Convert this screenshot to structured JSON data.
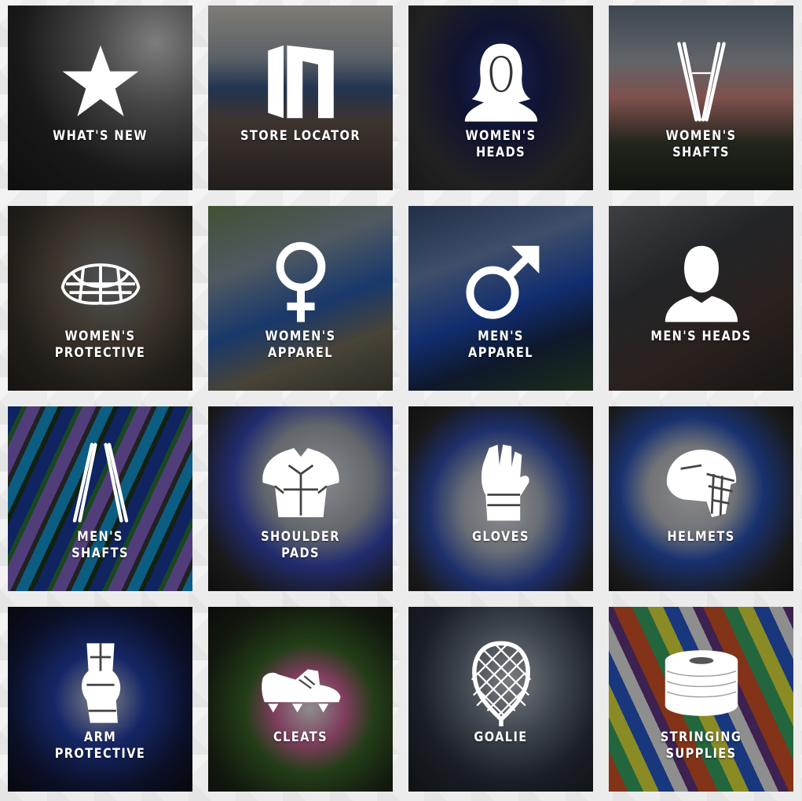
{
  "colors": {
    "page_background": "#ececec",
    "label_text": "#ffffff",
    "icon_fill": "#ffffff"
  },
  "tiles": [
    {
      "label": "WHAT'S NEW",
      "icon": "star-icon"
    },
    {
      "label": "STORE LOCATOR",
      "icon": "store-logo-icon"
    },
    {
      "label": "WOMEN'S\nHEADS",
      "icon": "woman-silhouette-icon"
    },
    {
      "label": "WOMEN'S\nSHAFTS",
      "icon": "shafts-icon"
    },
    {
      "label": "WOMEN'S\nPROTECTIVE",
      "icon": "goggles-icon"
    },
    {
      "label": "WOMEN'S\nAPPAREL",
      "icon": "female-symbol-icon"
    },
    {
      "label": "MEN'S\nAPPAREL",
      "icon": "male-symbol-icon"
    },
    {
      "label": "MEN'S HEADS",
      "icon": "man-silhouette-icon"
    },
    {
      "label": "MEN'S\nSHAFTS",
      "icon": "shafts-icon"
    },
    {
      "label": "SHOULDER\nPADS",
      "icon": "shoulder-pads-icon"
    },
    {
      "label": "GLOVES",
      "icon": "glove-icon"
    },
    {
      "label": "HELMETS",
      "icon": "helmet-icon"
    },
    {
      "label": "ARM\nPROTECTIVE",
      "icon": "arm-pad-icon"
    },
    {
      "label": "CLEATS",
      "icon": "cleat-icon"
    },
    {
      "label": "GOALIE",
      "icon": "goalie-head-icon"
    },
    {
      "label": "STRINGING\nSUPPLIES",
      "icon": "spool-icon"
    }
  ]
}
